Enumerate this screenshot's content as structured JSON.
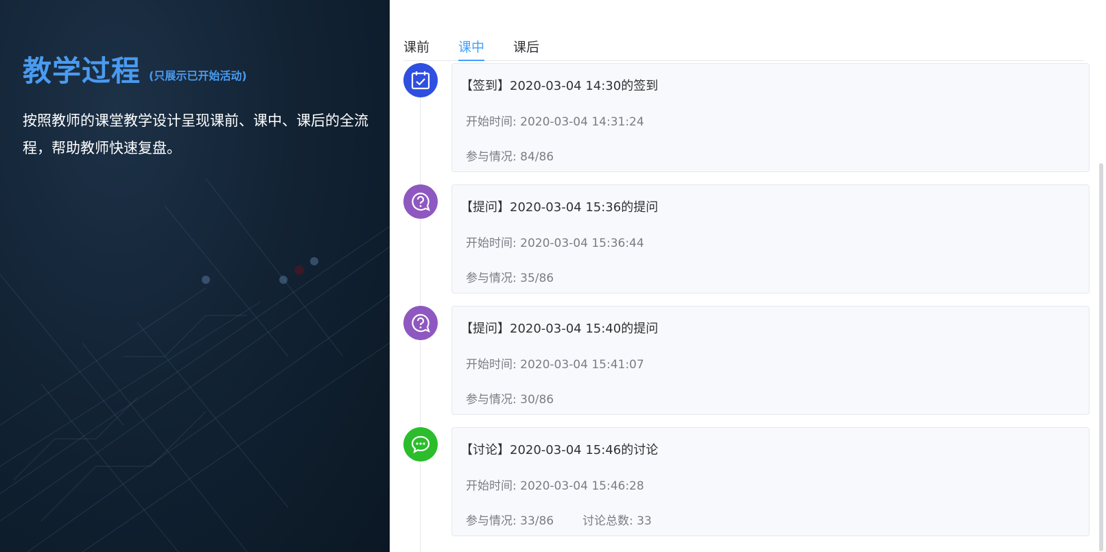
{
  "intro": {
    "title": "教学过程",
    "subtitle": "(只展示已开始活动)",
    "description": "按照教师的课堂教学设计呈现课前、课中、课后的全流程，帮助教师快速复盘。"
  },
  "tabs": [
    {
      "label": "课前",
      "active": false
    },
    {
      "label": "课中",
      "active": true
    },
    {
      "label": "课后",
      "active": false
    }
  ],
  "colors": {
    "accent": "#409eff",
    "signin": "#2f4fe0",
    "question": "#8e58c0",
    "discussion": "#2bbd2b"
  },
  "activities": [
    {
      "icon": "calendar-check-icon",
      "title": "【签到】2020-03-04 14:30的签到",
      "start": "开始时间: 2020-03-04 14:31:24",
      "participation": "参与情况: 84/86"
    },
    {
      "icon": "question-bubble-icon",
      "title": "【提问】2020-03-04 15:36的提问",
      "start": "开始时间: 2020-03-04 15:36:44",
      "participation": "参与情况: 35/86"
    },
    {
      "icon": "question-bubble-icon",
      "title": "【提问】2020-03-04 15:40的提问",
      "start": "开始时间: 2020-03-04 15:41:07",
      "participation": "参与情况: 30/86"
    },
    {
      "icon": "chat-bubble-icon",
      "title": "【讨论】2020-03-04 15:46的讨论",
      "start": "开始时间: 2020-03-04 15:46:28",
      "participation": "参与情况: 33/86",
      "total": "讨论总数: 33"
    }
  ]
}
